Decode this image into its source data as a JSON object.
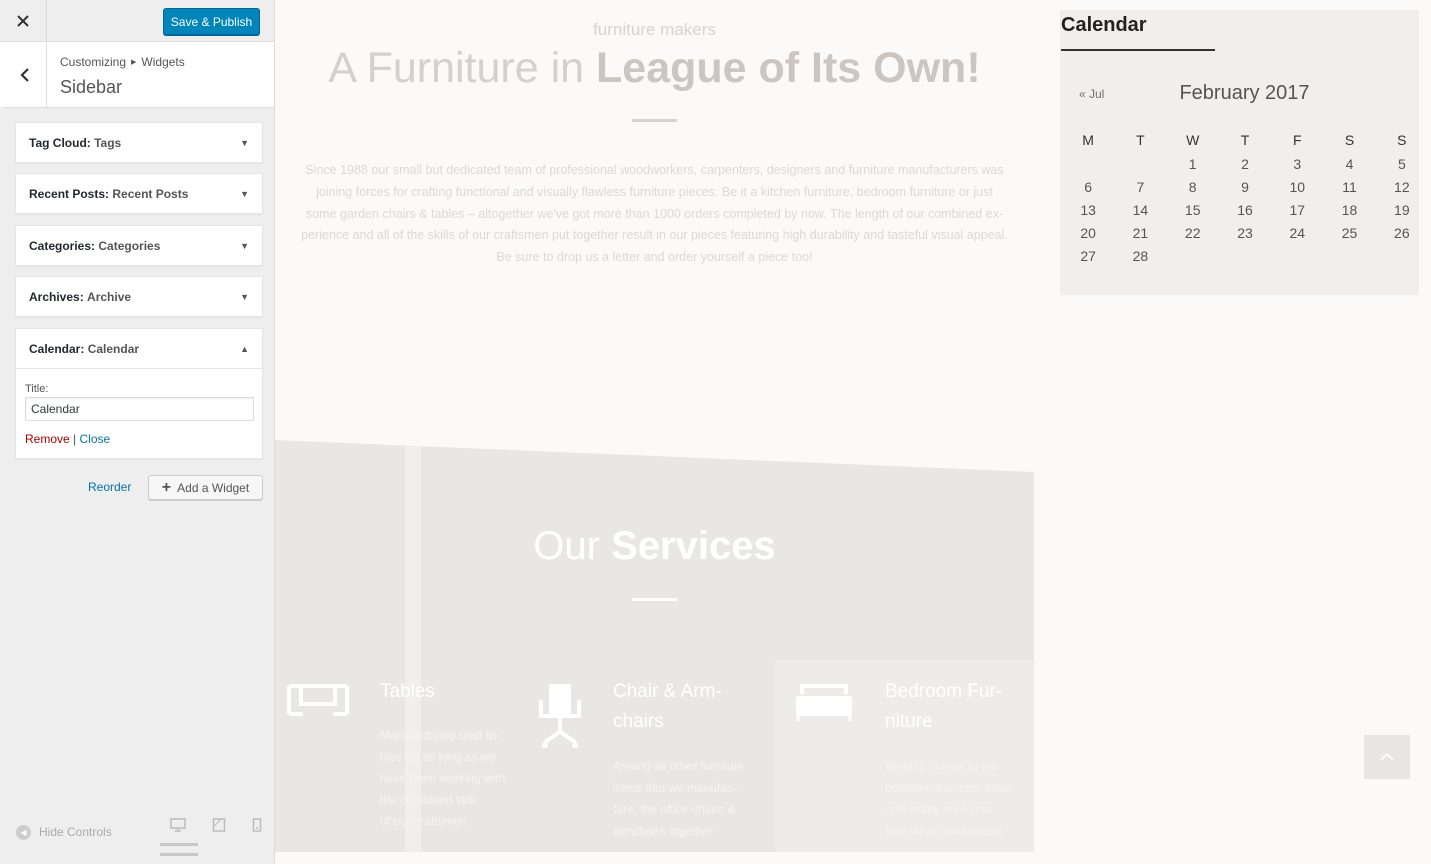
{
  "customizer": {
    "close_icon": "close-icon",
    "save_label": "Save & Publish",
    "breadcrumb": [
      "Customizing",
      "Widgets"
    ],
    "section_title": "Sidebar",
    "widgets": [
      {
        "type": "Tag Cloud:",
        "instance": "Tags",
        "expanded": false
      },
      {
        "type": "Recent Posts:",
        "instance": "Recent Posts",
        "expanded": false
      },
      {
        "type": "Categories:",
        "instance": "Categories",
        "expanded": false
      },
      {
        "type": "Archives:",
        "instance": "Archive",
        "expanded": false
      },
      {
        "type": "Calendar:",
        "instance": "Calendar",
        "expanded": true
      }
    ],
    "calendar_form": {
      "title_label": "Title:",
      "title_value": "Calendar",
      "remove_label": "Remove",
      "separator": "|",
      "close_label": "Close"
    },
    "reorder_label": "Reorder",
    "add_widget_label": "Add a Widget",
    "hide_controls_label": "Hide Controls",
    "devices": [
      "desktop-icon",
      "tablet-icon",
      "mobile-icon"
    ]
  },
  "preview": {
    "tagline": "furniture makers",
    "hero_title_light": "A Furniture in",
    "hero_title_bold": "League of Its Own!",
    "hero_text": [
      "Since 1988 our small but dedicated team of professional woodworkers, carpenters, designers and furniture manufacturers was",
      "joining forces for crafting functional and visually flawless furniture pieces. Be it a kitchen furniture, bedroom furniture or just",
      "some garden chairs & tables – altogether we've got more than 1000 orders completed by now. The length of our combined ex-",
      "perience and all of the skills of our craftsmen put together result in our pieces featuring high durability and tasteful visual appeal.",
      "Be sure to drop us a letter and order yourself a piece too!"
    ],
    "services_title_light": "Our",
    "services_title_bold": "Services",
    "services": [
      {
        "icon": "table-icon",
        "name_lines": [
          "Tables"
        ],
        "desc_lines": [
          "Manufacturing craft ta-",
          "bles for as long as we",
          "have been working with",
          "the combined skill",
          "of our craftsmen"
        ]
      },
      {
        "icon": "chair-icon",
        "name_lines": [
          "Chair & Arm-",
          "chairs"
        ],
        "desc_lines": [
          "Among all other furniture",
          "items that we manufac-",
          "ture, the office chairs &",
          "armchairs together"
        ]
      },
      {
        "icon": "bed-icon",
        "name_lines": [
          "Bedroom Fur-",
          "niture"
        ],
        "desc_lines": [
          "When it comes to the",
          "bedroom the main focus",
          "is to make sure your",
          "bed stays comfortable"
        ]
      }
    ],
    "calendar": {
      "heading": "Calendar",
      "prev_link": "« Jul",
      "month": "February 2017",
      "weekdays": [
        "M",
        "T",
        "W",
        "T",
        "F",
        "S",
        "S"
      ],
      "weeks": [
        [
          "",
          "",
          "1",
          "2",
          "3",
          "4",
          "5"
        ],
        [
          "6",
          "7",
          "8",
          "9",
          "10",
          "11",
          "12"
        ],
        [
          "13",
          "14",
          "15",
          "16",
          "17",
          "18",
          "19"
        ],
        [
          "20",
          "21",
          "22",
          "23",
          "24",
          "25",
          "26"
        ],
        [
          "27",
          "28",
          "",
          "",
          "",
          "",
          ""
        ]
      ]
    }
  }
}
